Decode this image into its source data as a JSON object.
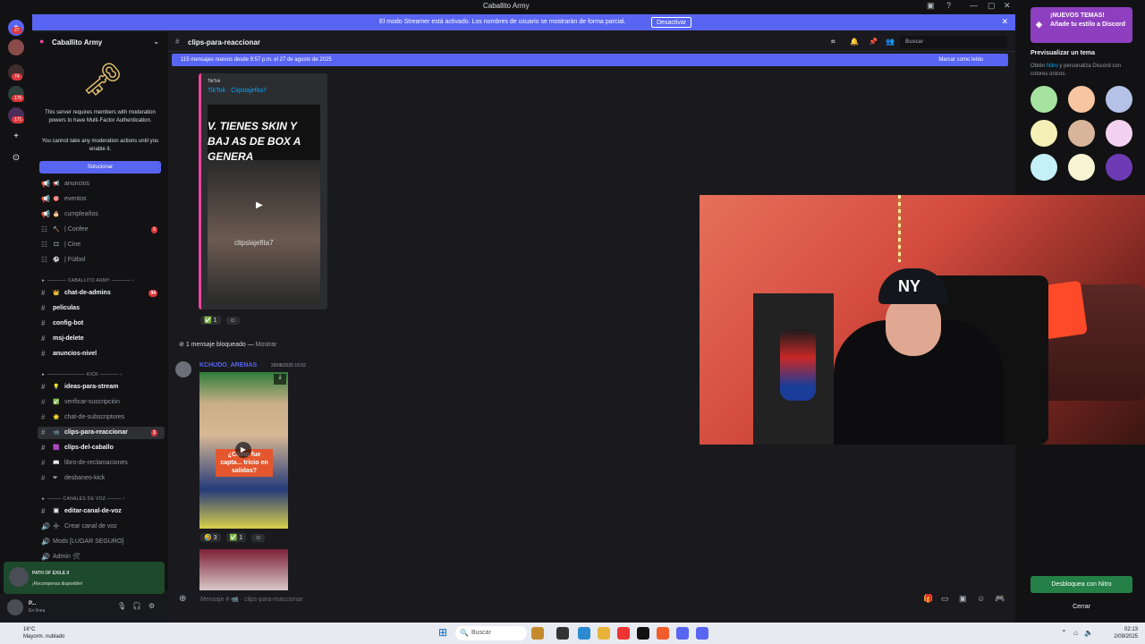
{
  "window": {
    "title": "Caballito Army",
    "controls": [
      "—",
      "▢",
      "✕"
    ]
  },
  "streamer_banner": {
    "text": "El modo Streamer está activado. Los nombres de usuario se mostrarán de forma parcial.",
    "button": "Desactivar"
  },
  "guild_rail": {
    "badges": [
      "27",
      "74",
      "176",
      "171"
    ]
  },
  "server": {
    "name": "Caballito Army"
  },
  "mfa_notice": {
    "line1": "This server requires members with moderation powers to have Multi-Factor Authentication.",
    "line2": "You cannot take any moderation actions until you enable it.",
    "button": "Solucionar"
  },
  "channels": [
    {
      "label": "anuncios",
      "emoji": "📢",
      "bold": false
    },
    {
      "label": "eventos",
      "emoji": "🎯",
      "bold": false
    },
    {
      "label": "cumpleaños",
      "emoji": "🎂",
      "bold": false
    },
    {
      "label": "| Confee",
      "emoji": "🔨",
      "bold": false,
      "badge": "6"
    },
    {
      "label": "| Cine",
      "emoji": "🎞",
      "bold": false
    },
    {
      "label": "| Fútbol",
      "emoji": "⚽",
      "bold": false
    },
    {
      "label": "chat-de-admins",
      "emoji": "👑",
      "bold": true,
      "badge": "94"
    },
    {
      "label": "peliculas",
      "emoji": "",
      "bold": true
    },
    {
      "label": "config-bot",
      "emoji": "",
      "bold": true
    },
    {
      "label": "msj-delete",
      "emoji": "",
      "bold": true
    },
    {
      "label": "anuncios-nivel",
      "emoji": "",
      "bold": true
    },
    {
      "label": "ideas-para-stream",
      "emoji": "💡",
      "bold": true
    },
    {
      "label": "verificar-suscripción",
      "emoji": "✅",
      "bold": false
    },
    {
      "label": "chat-de-subscriptores",
      "emoji": "🌟",
      "bold": false
    },
    {
      "label": "clips-para-reaccionar",
      "emoji": "📹",
      "bold": true,
      "badge": "1",
      "active": true
    },
    {
      "label": "clips-del-caballo",
      "emoji": "🟪",
      "bold": true
    },
    {
      "label": "libro-de-reclamaciones",
      "emoji": "📖",
      "bold": false
    },
    {
      "label": "desbaneo-kick",
      "emoji": "❤",
      "bold": false
    },
    {
      "label": "editar-canal-de-voz",
      "emoji": "🔲",
      "bold": true
    },
    {
      "label": "Crear canal de voz",
      "emoji": "➕",
      "bold": false
    },
    {
      "label": "Mods [LUGAR SEGURO]",
      "emoji": "",
      "bold": false
    },
    {
      "label": "Admin 🛠",
      "emoji": "",
      "bold": false
    }
  ],
  "categories": [
    "CABALLITO ARMY",
    "KICK",
    "CANALES DE VOZ"
  ],
  "activity": {
    "title": "PATH OF EXILE II",
    "subtitle": "¡Recompensa disponible!"
  },
  "user": {
    "name": "P...",
    "status": "En línea"
  },
  "channel_header": {
    "name": "clips-para-reaccionar",
    "search_placeholder": "Buscar"
  },
  "new_messages_bar": {
    "text": "115 mensajes nuevos desde 9:57 p.m. el 27 de agosto de 2025",
    "mark_read": "Marcar como leído"
  },
  "embed": {
    "provider": "TikTok",
    "title": "TikTok · Clipslajefita7",
    "caption": "V. TIENES SKIN Y BAJ AS DE BOX A GENERA",
    "watermark": "clipslajefita7"
  },
  "reactions_1": [
    {
      "emoji": "✅",
      "count": "1"
    }
  ],
  "blocked": {
    "text": "1 mensaje bloqueado — ",
    "show": "Mostrar"
  },
  "message2": {
    "author": "KCHUDO_ARENAS",
    "time": "29/08/2025 16:52",
    "clip_caption": "¿Cómo fue capta... tricio en salidas?"
  },
  "reactions_2": [
    {
      "emoji": "🤣",
      "count": "3"
    },
    {
      "emoji": "✅",
      "count": "1"
    }
  ],
  "composer": {
    "placeholder": "Mensaje # 📹 · clips-para-reaccionar"
  },
  "right_panel": {
    "promo_title": "¡NUEVOS TEMAS!",
    "promo_sub": "Añade tu estilo a Discord",
    "preview_title": "Previsualizar un tema",
    "preview_desc_pre": "Obtén ",
    "preview_desc_nitro": "Nitro",
    "preview_desc_post": " y personaliza Discord con colores únicos.",
    "swatches": [
      "#a6e3a1",
      "#f7c59f",
      "#b5c2e8",
      "#f5f0b6",
      "#d8b49a",
      "#f3d1f0",
      "#c4f0f7",
      "#f7f3d3",
      "#6f3bb5"
    ],
    "unlock_button": "Desbloquea con Nitro",
    "close_button": "Cerrar"
  },
  "taskbar": {
    "temp": "16°C",
    "weather": "Mayorm. nublado",
    "search": "Buscar",
    "time": "02:13",
    "date": "2/09/2025"
  }
}
